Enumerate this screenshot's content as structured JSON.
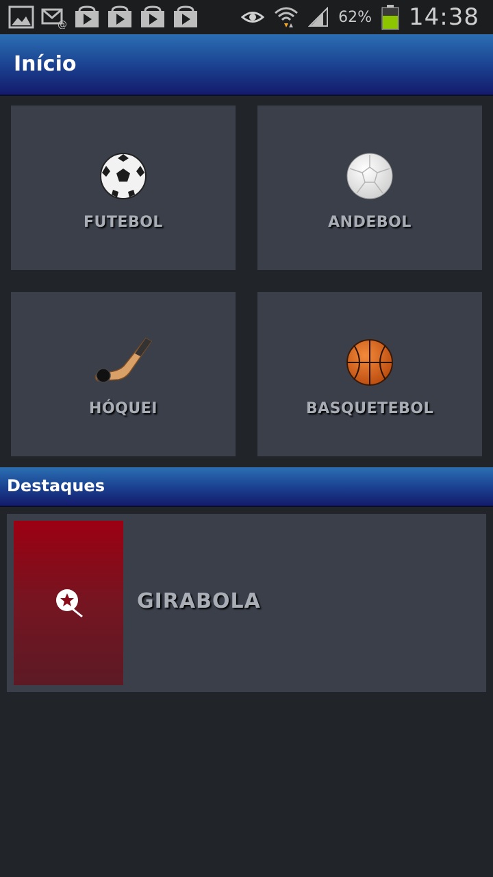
{
  "status_bar": {
    "battery": "62%",
    "time": "14:38",
    "left_icons": [
      "image-icon",
      "email-icon",
      "play-store-icon",
      "play-store-icon",
      "play-store-icon",
      "play-store-icon"
    ],
    "battery_color": "#8dc500"
  },
  "app_bar": {
    "title": "Início"
  },
  "sports": [
    {
      "label": "FUTEBOL",
      "icon": "soccer-ball-icon"
    },
    {
      "label": "ANDEBOL",
      "icon": "handball-icon"
    },
    {
      "label": "HÓQUEI",
      "icon": "hockey-stick-icon"
    },
    {
      "label": "BASQUETEBOL",
      "icon": "basketball-icon"
    }
  ],
  "highlights": {
    "title": "Destaques",
    "items": [
      {
        "label": "GIRABOLA",
        "icon": "girabola-logo-icon"
      }
    ]
  },
  "colors": {
    "accent": "#1a3f8e",
    "tile_bg": "#3a3f4a",
    "page_bg": "#212529",
    "highlight_thumb": "#8a0a18"
  }
}
